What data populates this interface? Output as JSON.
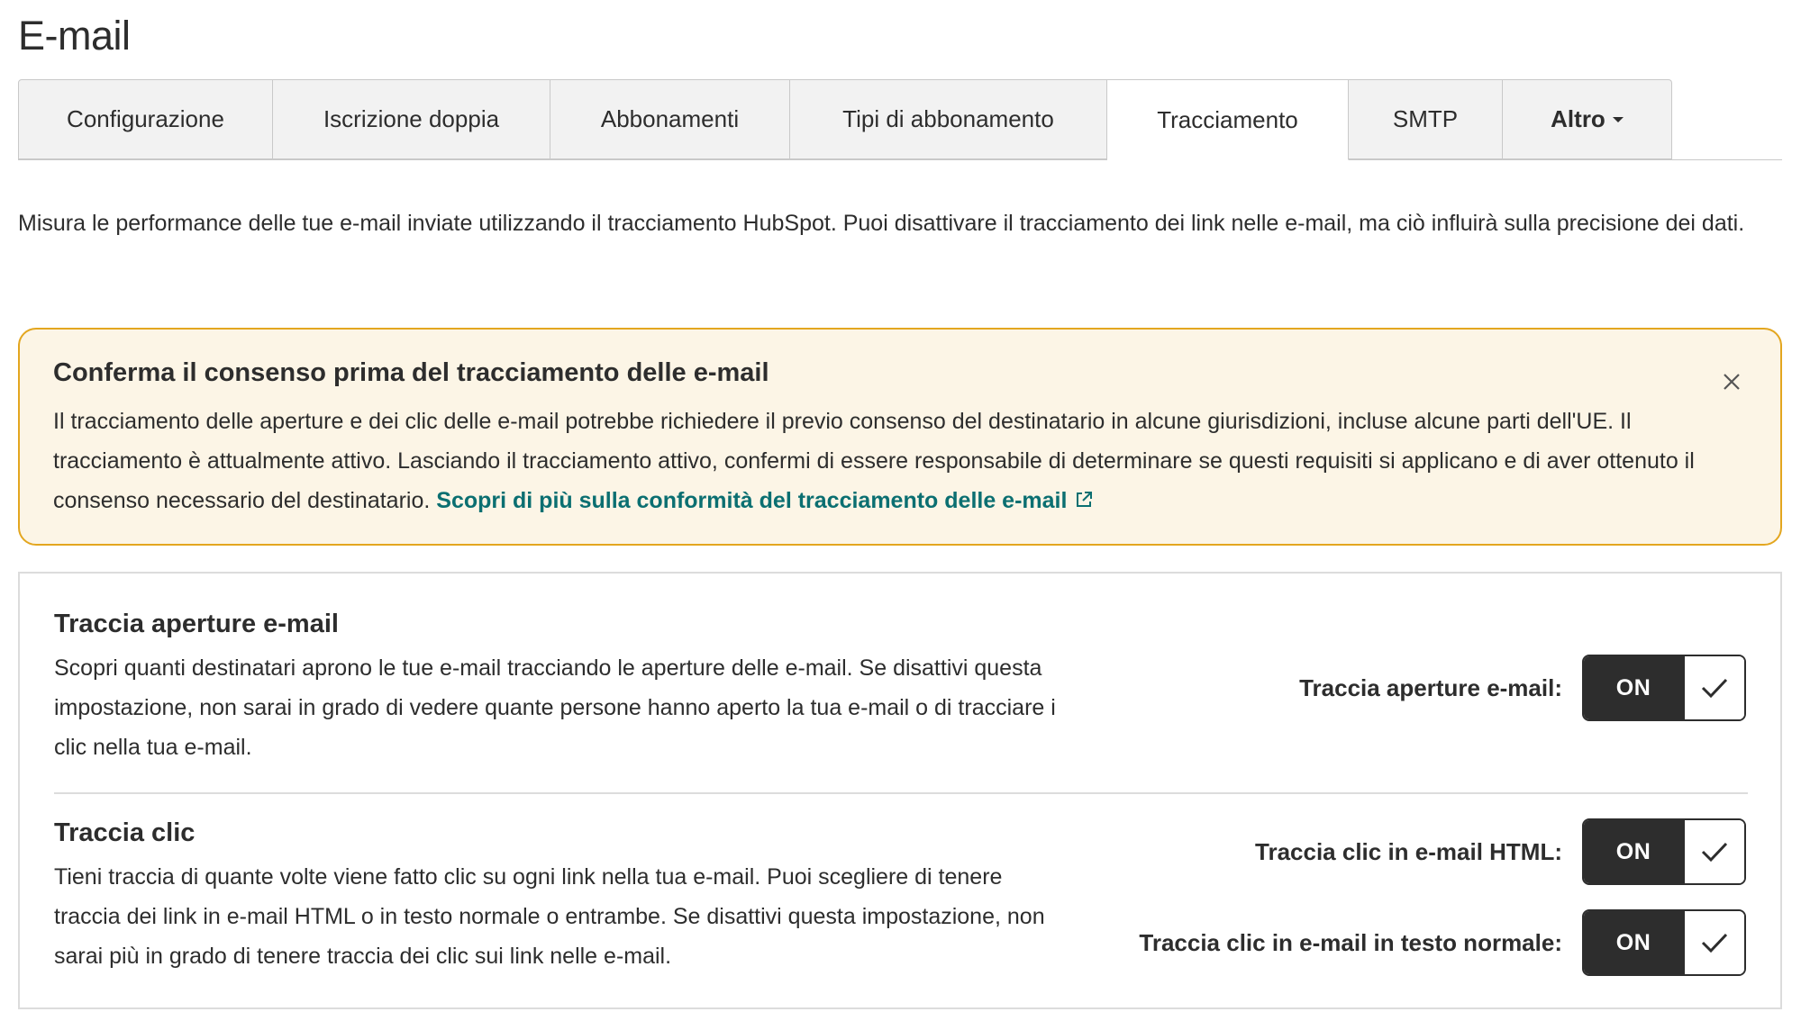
{
  "page": {
    "title": "E-mail"
  },
  "tabs": [
    {
      "label": "Configurazione"
    },
    {
      "label": "Iscrizione doppia"
    },
    {
      "label": "Abbonamenti"
    },
    {
      "label": "Tipi di abbonamento"
    },
    {
      "label": "Tracciamento",
      "active": true
    },
    {
      "label": "SMTP"
    },
    {
      "label": "Altro",
      "dropdown": true
    }
  ],
  "intro": "Misura le performance delle tue e-mail inviate utilizzando il tracciamento HubSpot. Puoi disattivare il tracciamento dei link nelle e-mail, ma ciò influirà sulla precisione dei dati.",
  "alert": {
    "title": "Conferma il consenso prima del tracciamento delle e-mail",
    "body": "Il tracciamento delle aperture e dei clic delle e-mail potrebbe richiedere il previo consenso del destinatario in alcune giurisdizioni, incluse alcune parti dell'UE. Il tracciamento è attualmente attivo. Lasciando il tracciamento attivo, confermi di essere responsabile di determinare se questi requisiti si applicano e di aver ottenuto il consenso necessario del destinatario.",
    "link": "Scopri di più sulla conformità del tracciamento delle e-mail",
    "close_icon": "close-icon",
    "link_icon": "external-link-icon",
    "accent_color": "#e3a61f",
    "background_color": "#fcf5e6"
  },
  "sections": {
    "opens": {
      "title": "Traccia aperture e-mail",
      "description": "Scopri quanti destinatari aprono le tue e-mail tracciando le aperture delle e-mail. Se disattivi questa impostazione, non sarai in grado di vedere quante persone hanno aperto la tua e-mail o di tracciare i clic nella tua e-mail.",
      "toggle": {
        "label": "Traccia aperture e-mail:",
        "state": "ON",
        "icon": "check-icon"
      }
    },
    "clicks": {
      "title": "Traccia clic",
      "description": "Tieni traccia di quante volte viene fatto clic su ogni link nella tua e-mail. Puoi scegliere di tenere traccia dei link in e-mail HTML o in testo normale o entrambe. Se disattivi questa impostazione, non sarai più in grado di tenere traccia dei clic sui link nelle e-mail.",
      "toggle_html": {
        "label": "Traccia clic in e-mail HTML:",
        "state": "ON",
        "icon": "check-icon"
      },
      "toggle_plain": {
        "label": "Traccia clic in e-mail in testo normale:",
        "state": "ON",
        "icon": "check-icon"
      }
    }
  },
  "colors": {
    "text": "#2d2d2d",
    "link": "#0b6f71",
    "toggle_dark": "#2d2d2d"
  }
}
